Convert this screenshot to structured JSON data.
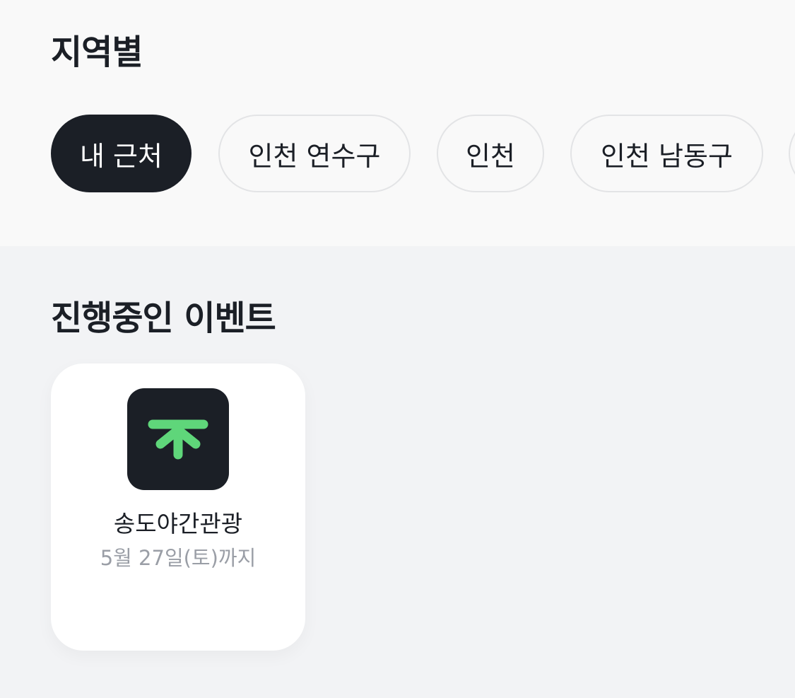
{
  "region": {
    "title": "지역별",
    "chips": [
      {
        "label": "내 근처",
        "active": true
      },
      {
        "label": "인천 연수구",
        "active": false
      },
      {
        "label": "인천",
        "active": false
      },
      {
        "label": "인천 남동구",
        "active": false
      }
    ]
  },
  "events": {
    "title": "진행중인 이벤트",
    "items": [
      {
        "name": "송도야간관광",
        "period": "5월 27일(토)까지",
        "logo_icon": "tree-arrow-icon",
        "logo_bg": "#1b1f26",
        "logo_color": "#5fd67a"
      }
    ]
  },
  "colors": {
    "active_chip": "#1b1f26",
    "chip_border": "#e3e4e6",
    "muted_text": "#9a9ea6"
  }
}
